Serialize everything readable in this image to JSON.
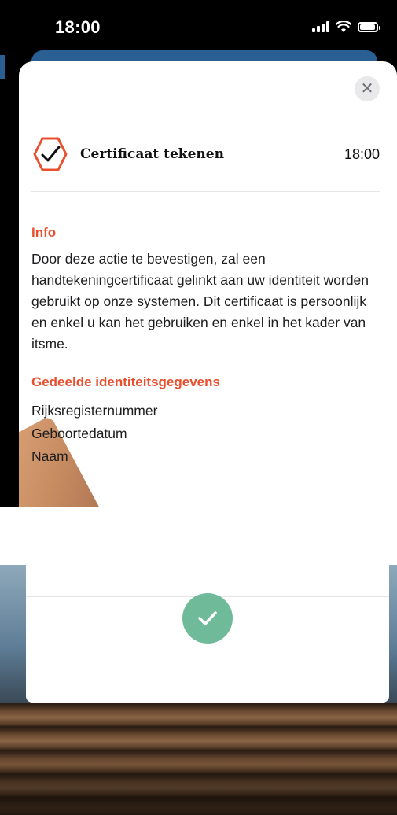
{
  "status_bar": {
    "time": "18:00"
  },
  "sheet": {
    "title": "Certificaat tekenen",
    "time": "18:00",
    "close_icon": "close-icon",
    "logo_icon": "hexagon-checkmark-icon"
  },
  "info": {
    "heading": "Info",
    "text": "Door deze actie te bevestigen, zal een handtekeningcertificaat gelinkt aan uw identiteit worden gebruikt op onze systemen. Dit certificaat is persoonlijk en enkel u kan het gebruiken en enkel in het kader van itsme."
  },
  "shared": {
    "heading": "Gedeelde identiteitsgegevens",
    "items": [
      "Rijksregisternummer",
      "Geboortedatum",
      "Naam"
    ]
  },
  "colors": {
    "accent": "#e8502f",
    "success": "#6fba98",
    "sheet_blue": "#2a5f93"
  }
}
